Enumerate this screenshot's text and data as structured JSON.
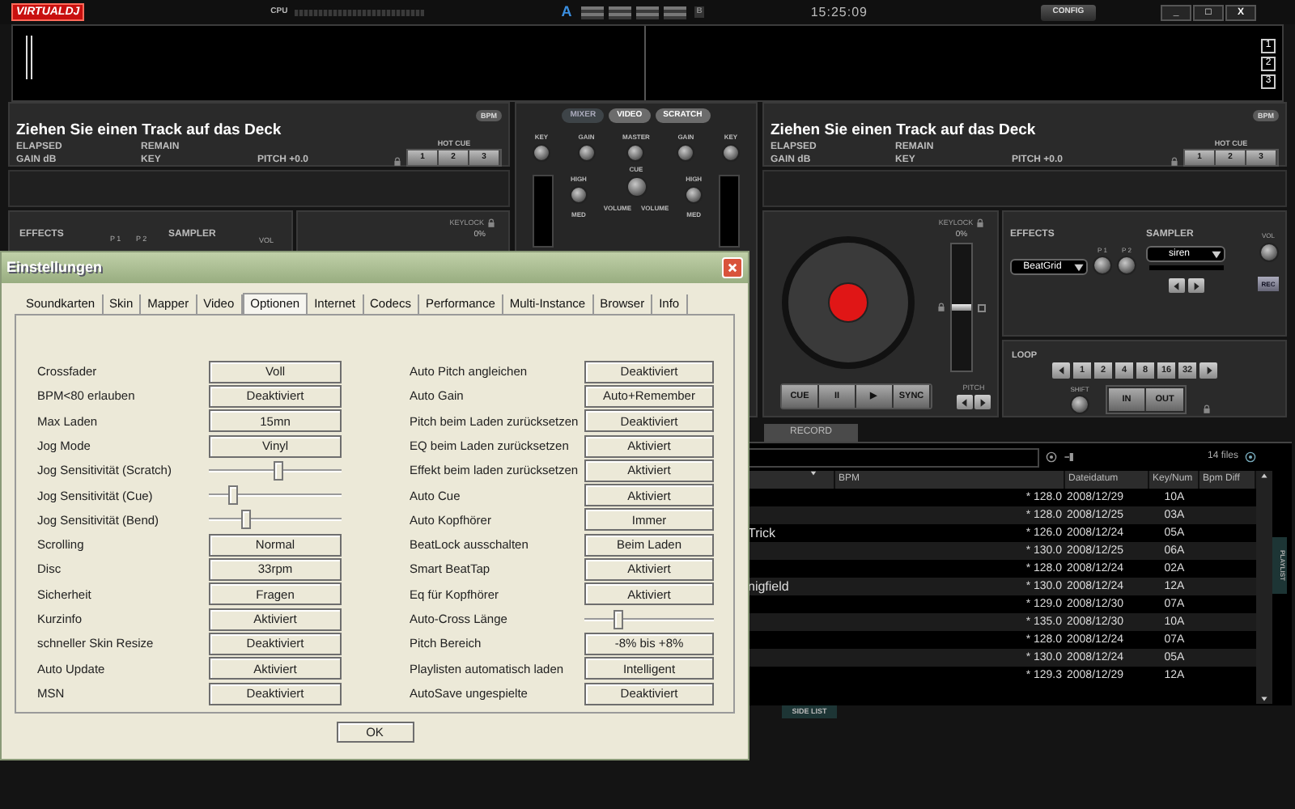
{
  "topbar": {
    "logo": "VIRTUALDJ",
    "cpu_label": "CPU",
    "deck_a": "A",
    "deck_b": "B",
    "clock": "15:25:09",
    "config_button": "CONFIG",
    "window_buttons": [
      "_",
      "□",
      "X"
    ]
  },
  "waveform": {
    "deck_numbers": [
      "1",
      "2",
      "3"
    ]
  },
  "left_deck": {
    "title": "Ziehen Sie einen Track auf das Deck",
    "bpm_badge": "BPM",
    "elapsed": "ELAPSED",
    "remain": "REMAIN",
    "gain": "GAIN dB",
    "key": "KEY",
    "pitch": "PITCH +0.0",
    "hot_cue_label": "HOT CUE",
    "hot_cues": [
      "1",
      "2",
      "3"
    ],
    "effects_label": "EFFECTS",
    "effect_params": [
      "P 1",
      "P 2"
    ],
    "sampler_label": "SAMPLER",
    "vol_label": "VOL",
    "keylock_label": "KEYLOCK",
    "pitch_percent": "0%"
  },
  "mixer": {
    "tabs": [
      {
        "label": "MIXER",
        "selected": true
      },
      {
        "label": "VIDEO",
        "selected": false
      },
      {
        "label": "SCRATCH",
        "selected": false
      }
    ],
    "top_knobs": [
      "KEY",
      "GAIN",
      "MASTER",
      "GAIN",
      "KEY"
    ],
    "high_labels": [
      "HIGH",
      "HIGH"
    ],
    "cue_label": "CUE",
    "med_labels": [
      "MED",
      "MED"
    ],
    "volume_labels": [
      "VOLUME",
      "VOLUME"
    ]
  },
  "right_deck": {
    "title": "Ziehen Sie einen Track auf das Deck",
    "bpm_badge": "BPM",
    "elapsed": "ELAPSED",
    "remain": "REMAIN",
    "gain": "GAIN dB",
    "key": "KEY",
    "pitch": "PITCH +0.0",
    "hot_cue_label": "HOT CUE",
    "hot_cues": [
      "1",
      "2",
      "3"
    ],
    "keylock_label": "KEYLOCK",
    "pitch_percent": "0%",
    "pitch_slider": {
      "level": 0.5
    },
    "transport": [
      "CUE",
      "II",
      "▶",
      "SYNC"
    ],
    "pitch_label": "PITCH",
    "effects_label": "EFFECTS",
    "effect": "BeatGrid",
    "effect_params": [
      "P 1",
      "P 2"
    ],
    "sampler_label": "SAMPLER",
    "sample": "siren",
    "vol_label": "VOL",
    "rec_button": "REC",
    "loop_label": "LOOP",
    "loop_buttons": [
      "1",
      "2",
      "4",
      "8",
      "16",
      "32"
    ],
    "shift_label": "SHIFT",
    "in_button": "IN",
    "out_button": "OUT"
  },
  "browser": {
    "tab": "RECORD",
    "files_count": "14 files",
    "columns": [
      "BPM",
      "Dateidatum",
      "Key/Num",
      "Bpm Diff"
    ],
    "rows": [
      {
        "bpm": "* 128.0",
        "date": "2008/12/29",
        "key": "10A"
      },
      {
        "bpm": "* 128.0",
        "date": "2008/12/25",
        "key": "03A"
      },
      {
        "title": "Trick",
        "bpm": "* 126.0",
        "date": "2008/12/24",
        "key": "05A"
      },
      {
        "bpm": "* 130.0",
        "date": "2008/12/25",
        "key": "06A"
      },
      {
        "bpm": "* 128.0",
        "date": "2008/12/24",
        "key": "02A"
      },
      {
        "title": "nigfield",
        "bpm": "* 130.0",
        "date": "2008/12/24",
        "key": "12A"
      },
      {
        "bpm": "* 129.0",
        "date": "2008/12/30",
        "key": "07A"
      },
      {
        "bpm": "* 135.0",
        "date": "2008/12/30",
        "key": "10A"
      },
      {
        "bpm": "* 128.0",
        "date": "2008/12/24",
        "key": "07A"
      },
      {
        "bpm": "* 130.0",
        "date": "2008/12/24",
        "key": "05A"
      },
      {
        "bpm": "* 129.3",
        "date": "2008/12/29",
        "key": "12A"
      }
    ],
    "side_list_tab": "SIDE LIST",
    "playlist_tab": "PLAYLIST"
  },
  "dialog": {
    "title": "Einstellungen",
    "tabs": [
      {
        "label": "Soundkarten",
        "selected": false
      },
      {
        "label": "Skin",
        "selected": false
      },
      {
        "label": "Mapper",
        "selected": false
      },
      {
        "label": "Video",
        "selected": false
      },
      {
        "label": "Optionen",
        "selected": true
      },
      {
        "label": "Internet",
        "selected": false
      },
      {
        "label": "Codecs",
        "selected": false
      },
      {
        "label": "Performance",
        "selected": false
      },
      {
        "label": "Multi-Instance",
        "selected": false
      },
      {
        "label": "Browser",
        "selected": false
      },
      {
        "label": "Info",
        "selected": false
      }
    ],
    "left_options": [
      {
        "kind": "button",
        "label": "Crossfader",
        "value": "Voll"
      },
      {
        "kind": "button",
        "label": "BPM<80 erlauben",
        "value": "Deaktiviert"
      },
      {
        "kind": "button",
        "label": "Max Laden",
        "value": "15mn"
      },
      {
        "kind": "button",
        "label": "Jog Mode",
        "value": "Vinyl"
      },
      {
        "kind": "slider",
        "label": "Jog Sensitivität (Scratch)",
        "level": 0.53
      },
      {
        "kind": "slider",
        "label": "Jog Sensitivität (Cue)",
        "level": 0.18
      },
      {
        "kind": "slider",
        "label": "Jog Sensitivität (Bend)",
        "level": 0.28
      },
      {
        "kind": "button",
        "label": "Scrolling",
        "value": "Normal"
      },
      {
        "kind": "button",
        "label": "Disc",
        "value": "33rpm"
      },
      {
        "kind": "button",
        "label": "Sicherheit",
        "value": "Fragen"
      },
      {
        "kind": "button",
        "label": "Kurzinfo",
        "value": "Aktiviert"
      },
      {
        "kind": "button",
        "label": "schneller Skin Resize",
        "value": "Deaktiviert"
      },
      {
        "kind": "button",
        "label": "Auto Update",
        "value": "Aktiviert"
      },
      {
        "kind": "button",
        "label": "MSN",
        "value": "Deaktiviert"
      }
    ],
    "right_options": [
      {
        "kind": "button",
        "label": "Auto Pitch angleichen",
        "value": "Deaktiviert"
      },
      {
        "kind": "button",
        "label": "Auto Gain",
        "value": "Auto+Remember"
      },
      {
        "kind": "button",
        "label": "Pitch beim Laden zurücksetzen",
        "value": "Deaktiviert"
      },
      {
        "kind": "button",
        "label": "EQ beim Laden zurücksetzen",
        "value": "Aktiviert"
      },
      {
        "kind": "button",
        "label": "Effekt beim laden zurücksetzen",
        "value": "Aktiviert"
      },
      {
        "kind": "button",
        "label": "Auto Cue",
        "value": "Aktiviert"
      },
      {
        "kind": "button",
        "label": "Auto Kopfhörer",
        "value": "Immer"
      },
      {
        "kind": "button",
        "label": "BeatLock ausschalten",
        "value": "Beim Laden"
      },
      {
        "kind": "button",
        "label": "Smart BeatTap",
        "value": "Aktiviert"
      },
      {
        "kind": "button",
        "label": "Eq für Kopfhörer",
        "value": "Aktiviert"
      },
      {
        "kind": "slider",
        "label": "Auto-Cross Länge",
        "level": 0.26
      },
      {
        "kind": "button",
        "label": "Pitch Bereich",
        "value": "-8% bis +8%"
      },
      {
        "kind": "button",
        "label": "Playlisten automatisch laden",
        "value": "Intelligent"
      },
      {
        "kind": "button",
        "label": "AutoSave ungespielte",
        "value": "Deaktiviert"
      }
    ],
    "ok_button": "OK"
  }
}
